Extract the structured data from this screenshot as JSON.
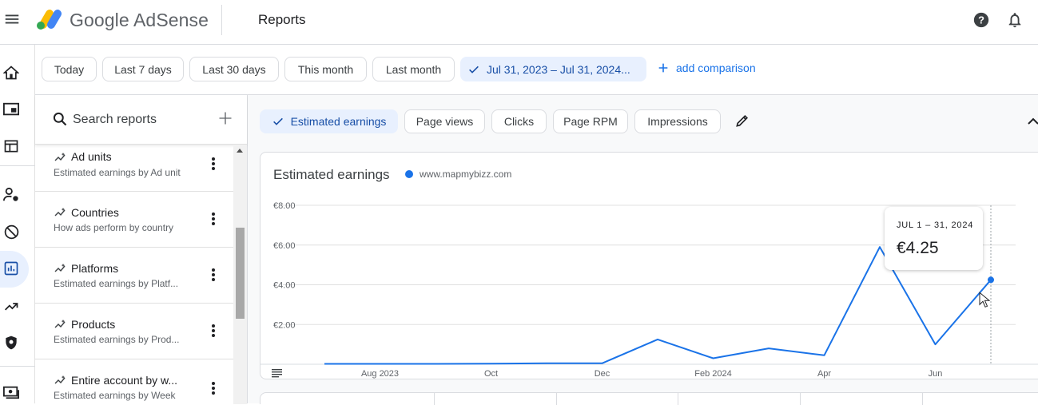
{
  "header": {
    "brand": "Google AdSense",
    "page_title": "Reports",
    "logo_colors": [
      "#fbbc04",
      "#34a853",
      "#4285f4"
    ]
  },
  "date_filters": {
    "items": [
      "Today",
      "Last 7 days",
      "Last 30 days",
      "This month",
      "Last month"
    ],
    "selected_range": "Jul 31, 2023 – Jul 31, 2024...",
    "add_comparison": "add comparison"
  },
  "reports": {
    "search_placeholder": "Search reports",
    "items": [
      {
        "title": "Ad units",
        "subtitle": "Estimated earnings by Ad unit"
      },
      {
        "title": "Countries",
        "subtitle": "How ads perform by country"
      },
      {
        "title": "Platforms",
        "subtitle": "Estimated earnings by Platf..."
      },
      {
        "title": "Products",
        "subtitle": "Estimated earnings by Prod..."
      },
      {
        "title": "Entire account by w...",
        "subtitle": "Estimated earnings by Week"
      }
    ]
  },
  "metrics": {
    "items": [
      "Estimated earnings",
      "Page views",
      "Clicks",
      "Page RPM",
      "Impressions"
    ],
    "selected": "Estimated earnings"
  },
  "chart": {
    "title": "Estimated earnings",
    "legend": "www.mapmybizz.com",
    "line_color": "#1a73e8"
  },
  "tooltip": {
    "date": "JUL 1 – 31, 2024",
    "value": "€4.25"
  },
  "chart_data": {
    "type": "line",
    "ylabels": [
      "€8.00",
      "€6.00",
      "€4.00",
      "€2.00"
    ],
    "xlabels": [
      "Aug 2023",
      "Oct",
      "Dec",
      "Feb 2024",
      "Apr",
      "Jun"
    ],
    "ylim": [
      0,
      8
    ],
    "grid": true,
    "series": [
      {
        "name": "www.mapmybizz.com",
        "x": [
          "2023-07",
          "2023-08",
          "2023-09",
          "2023-10",
          "2023-11",
          "2023-12",
          "2024-01",
          "2024-02",
          "2024-03",
          "2024-04",
          "2024-05",
          "2024-06",
          "2024-07"
        ],
        "values": [
          0.02,
          0.02,
          0.02,
          0.03,
          0.05,
          0.05,
          1.25,
          0.3,
          0.8,
          0.45,
          5.9,
          1.0,
          4.25
        ]
      }
    ]
  }
}
